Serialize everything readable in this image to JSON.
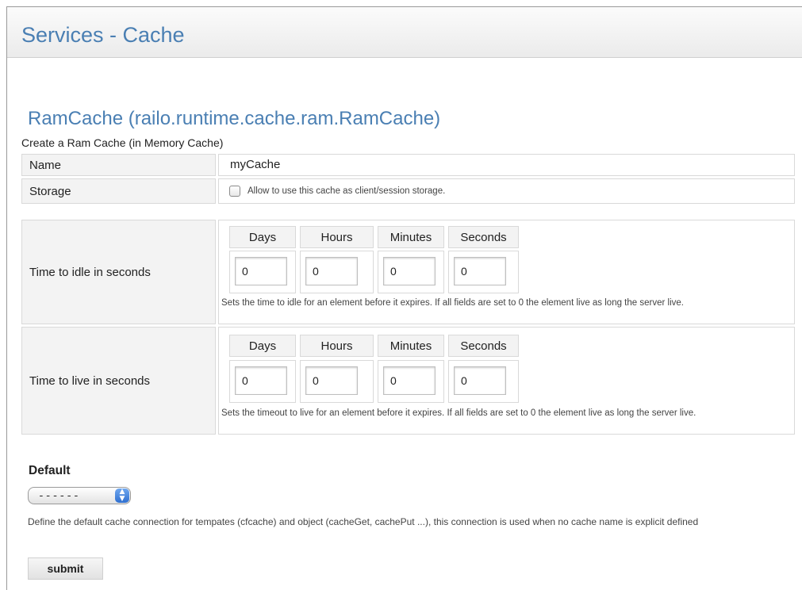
{
  "header": {
    "title": "Services - Cache"
  },
  "section": {
    "title": "RamCache (railo.runtime.cache.ram.RamCache)",
    "description": "Create a Ram Cache (in Memory Cache)"
  },
  "form": {
    "name_label": "Name",
    "name_value": "myCache",
    "storage_label": "Storage",
    "storage_checked": false,
    "storage_text": "Allow to use this cache as client/session storage.",
    "idle": {
      "label": "Time to idle in seconds",
      "headers": [
        "Days",
        "Hours",
        "Minutes",
        "Seconds"
      ],
      "values": [
        "0",
        "0",
        "0",
        "0"
      ],
      "help": "Sets the time to idle for an element before it expires. If all fields are set to 0 the element live as long the server live."
    },
    "live": {
      "label": "Time to live in seconds",
      "headers": [
        "Days",
        "Hours",
        "Minutes",
        "Seconds"
      ],
      "values": [
        "0",
        "0",
        "0",
        "0"
      ],
      "help": "Sets the timeout to live for an element before it expires. If all fields are set to 0 the element live as long the server live."
    }
  },
  "default": {
    "label": "Default",
    "selected": "------",
    "help": "Define the default cache connection for tempates (cfcache) and object (cacheGet, cachePut ...), this connection is used when no cache name is explicit defined"
  },
  "submit_label": "submit",
  "colors": {
    "accent": "#4a7fb3"
  }
}
